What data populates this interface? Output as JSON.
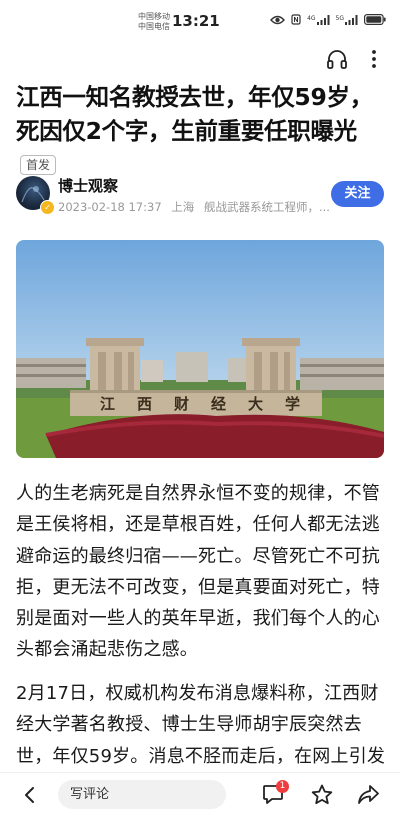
{
  "status_bar": {
    "carrier_1": "中国移动",
    "carrier_2": "中国电信",
    "time": "13:21",
    "signal_1": "4G",
    "signal_2": "5G"
  },
  "toolbar": {
    "icons": [
      "headphone-icon",
      "more-vertical-icon"
    ]
  },
  "article": {
    "title": "江西一知名教授去世，年仅59岁，死因仅2个字，生前重要任职曝光",
    "first_publish_tag": "首发",
    "author": {
      "name": "博士观察",
      "date": "2023-02-18 17:37",
      "location": "上海",
      "bio": "舰战武器系统工程师，..."
    },
    "follow_label": "关注",
    "image_sign_text": "江西财经大学",
    "paragraphs": [
      "人的生老病死是自然界永恒不变的规律，不管是王侯将相，还是草根百姓，任何人都无法逃避命运的最终归宿——死亡。尽管死亡不可抗拒，更无法不可改变，但是真要面对死亡，特别是面对一些人的英年早逝，我们每个人的心头都会涌起悲伤之感。",
      "2月17日，权威机构发布消息爆料称，江西财经大学著名教授、博士生导师胡宇辰突然去世，年仅59岁。消息不胫而走后，在网上引发"
    ]
  },
  "bottom_bar": {
    "comment_placeholder": "写评论",
    "comment_count": "1"
  },
  "colors": {
    "accent": "#3f6de6",
    "badge": "#f03c3c"
  }
}
